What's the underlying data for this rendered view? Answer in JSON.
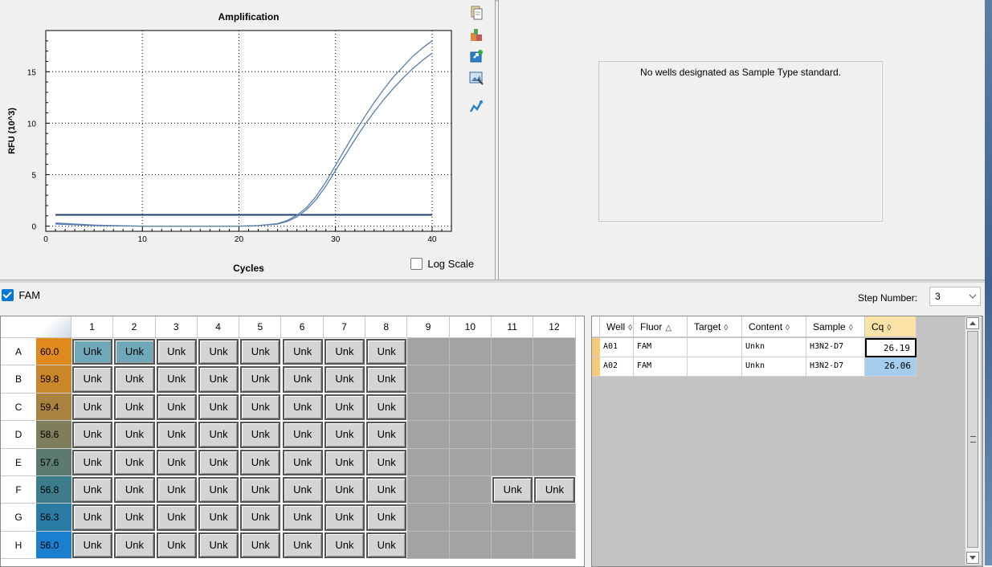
{
  "chart": {
    "title": "Amplification",
    "ylabel": "RFU (10^3)",
    "xlabel": "Cycles",
    "log_scale_label": "Log Scale",
    "log_scale_checked": false
  },
  "chart_data": {
    "type": "line",
    "title": "Amplification",
    "xlabel": "Cycles",
    "ylabel": "RFU (10^3)",
    "xlim": [
      0,
      42
    ],
    "ylim": [
      -0.5,
      19
    ],
    "xticks": [
      0,
      10,
      20,
      30,
      40
    ],
    "yticks": [
      0,
      5,
      10,
      15
    ],
    "grid": true,
    "log_scale": false,
    "threshold": 1.1,
    "series": [
      {
        "name": "A01",
        "x": [
          1,
          5,
          10,
          15,
          20,
          22,
          24,
          25,
          26,
          27,
          28,
          29,
          30,
          31,
          32,
          33,
          34,
          35,
          36,
          37,
          38,
          39,
          40
        ],
        "y": [
          0.2,
          0.05,
          0,
          0,
          0,
          0.05,
          0.2,
          0.45,
          0.9,
          1.6,
          2.6,
          3.9,
          5.4,
          6.9,
          8.4,
          9.8,
          11.1,
          12.3,
          13.4,
          14.4,
          15.3,
          16.1,
          16.8
        ]
      },
      {
        "name": "A02",
        "x": [
          1,
          5,
          10,
          15,
          20,
          22,
          24,
          25,
          26,
          27,
          28,
          29,
          30,
          31,
          32,
          33,
          34,
          35,
          36,
          37,
          38,
          39,
          40
        ],
        "y": [
          0.3,
          0.1,
          0,
          0,
          0,
          0.05,
          0.25,
          0.55,
          1.05,
          1.8,
          2.9,
          4.3,
          5.9,
          7.5,
          9.1,
          10.6,
          12,
          13.3,
          14.5,
          15.5,
          16.5,
          17.3,
          18
        ]
      }
    ],
    "colors": {
      "curve": "#5b7fae",
      "threshold": "#1f3f74"
    }
  },
  "standard_panel": {
    "message": "No wells designated as Sample Type standard."
  },
  "fluor_row": {
    "label": "FAM",
    "checked": true,
    "step_label": "Step Number:",
    "step_value": "3"
  },
  "plate": {
    "columns": [
      "1",
      "2",
      "3",
      "4",
      "5",
      "6",
      "7",
      "8",
      "9",
      "10",
      "11",
      "12"
    ],
    "rows": [
      {
        "label": "A",
        "temp": "60.0",
        "color": "#e08a1e",
        "wells": [
          "Unk",
          "Unk",
          "Unk",
          "Unk",
          "Unk",
          "Unk",
          "Unk",
          "Unk",
          "",
          "",
          "",
          ""
        ],
        "selected": [
          0,
          1
        ]
      },
      {
        "label": "B",
        "temp": "59.8",
        "color": "#c9872a",
        "wells": [
          "Unk",
          "Unk",
          "Unk",
          "Unk",
          "Unk",
          "Unk",
          "Unk",
          "Unk",
          "",
          "",
          "",
          ""
        ],
        "selected": []
      },
      {
        "label": "C",
        "temp": "59.4",
        "color": "#a98240",
        "wells": [
          "Unk",
          "Unk",
          "Unk",
          "Unk",
          "Unk",
          "Unk",
          "Unk",
          "Unk",
          "",
          "",
          "",
          ""
        ],
        "selected": []
      },
      {
        "label": "D",
        "temp": "58.6",
        "color": "#7e7d5c",
        "wells": [
          "Unk",
          "Unk",
          "Unk",
          "Unk",
          "Unk",
          "Unk",
          "Unk",
          "Unk",
          "",
          "",
          "",
          ""
        ],
        "selected": []
      },
      {
        "label": "E",
        "temp": "57.6",
        "color": "#5b7b72",
        "wells": [
          "Unk",
          "Unk",
          "Unk",
          "Unk",
          "Unk",
          "Unk",
          "Unk",
          "Unk",
          "",
          "",
          "",
          ""
        ],
        "selected": []
      },
      {
        "label": "F",
        "temp": "56.8",
        "color": "#3d7c8a",
        "wells": [
          "Unk",
          "Unk",
          "Unk",
          "Unk",
          "Unk",
          "Unk",
          "Unk",
          "Unk",
          "",
          "",
          "Unk",
          "Unk"
        ],
        "selected": []
      },
      {
        "label": "G",
        "temp": "56.3",
        "color": "#2a7ca4",
        "wells": [
          "Unk",
          "Unk",
          "Unk",
          "Unk",
          "Unk",
          "Unk",
          "Unk",
          "Unk",
          "",
          "",
          "",
          ""
        ],
        "selected": []
      },
      {
        "label": "H",
        "temp": "56.0",
        "color": "#1a7fcf",
        "wells": [
          "Unk",
          "Unk",
          "Unk",
          "Unk",
          "Unk",
          "Unk",
          "Unk",
          "Unk",
          "",
          "",
          "",
          ""
        ],
        "selected": []
      }
    ]
  },
  "table": {
    "columns": [
      {
        "label": "Well",
        "sort": "◊"
      },
      {
        "label": "Fluor",
        "sort": "△"
      },
      {
        "label": "Target",
        "sort": "◊"
      },
      {
        "label": "Content",
        "sort": "◊"
      },
      {
        "label": "Sample",
        "sort": "◊"
      },
      {
        "label": "Cq",
        "sort": "◊"
      }
    ],
    "rows": [
      [
        "A01",
        "FAM",
        "",
        "Unkn",
        "H3N2-D7",
        "26.19"
      ],
      [
        "A02",
        "FAM",
        "",
        "Unkn",
        "H3N2-D7",
        "26.06"
      ]
    ]
  },
  "toolbar_icons": [
    "copy-icon",
    "palette-icon",
    "export-icon",
    "image-icon",
    "chart-settings-icon"
  ]
}
